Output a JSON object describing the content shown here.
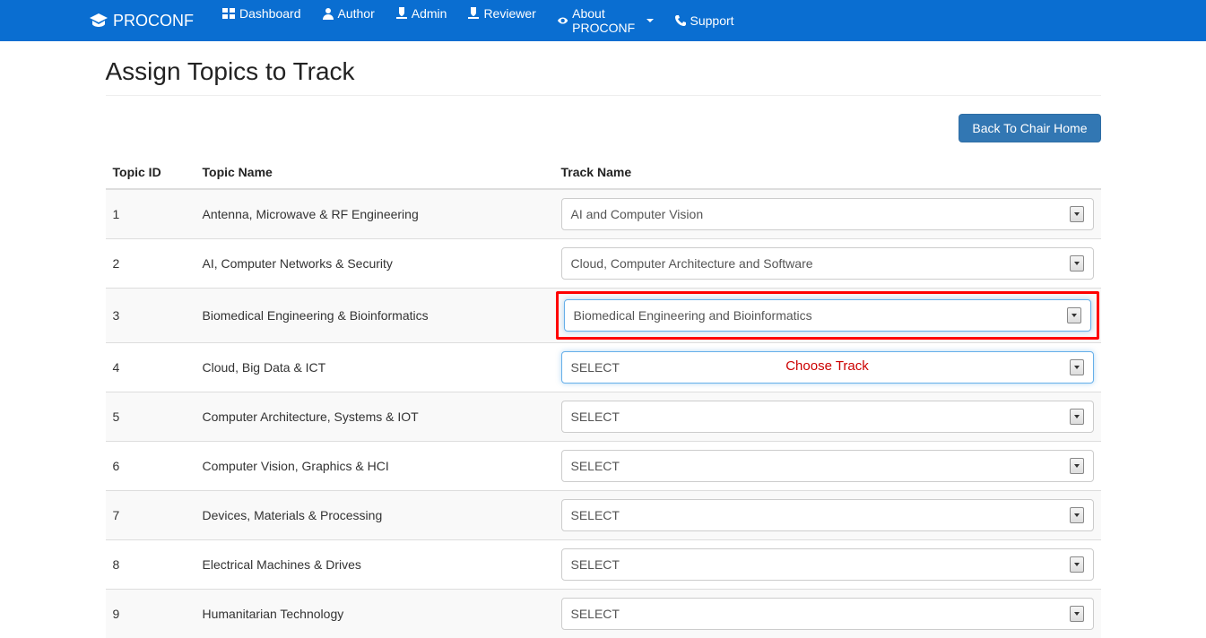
{
  "brand": "PROCONF",
  "nav": {
    "dashboard": "Dashboard",
    "author": "Author",
    "admin": "Admin",
    "reviewer": "Reviewer",
    "about": "About PROCONF",
    "support": "Support"
  },
  "page": {
    "title": "Assign Topics to Track",
    "back_btn": "Back To Chair Home",
    "annotation": "Choose Track"
  },
  "table": {
    "headers": {
      "id": "Topic ID",
      "name": "Topic Name",
      "track": "Track Name"
    },
    "rows": [
      {
        "id": "1",
        "name": "Antenna, Microwave & RF Engineering",
        "track": "AI and Computer Vision",
        "highlight": false,
        "focus": false
      },
      {
        "id": "2",
        "name": "AI, Computer Networks & Security",
        "track": "Cloud, Computer Architecture and Software",
        "highlight": false,
        "focus": false
      },
      {
        "id": "3",
        "name": "Biomedical Engineering & Bioinformatics",
        "track": "Biomedical Engineering and Bioinformatics",
        "highlight": true,
        "focus": true
      },
      {
        "id": "4",
        "name": "Cloud, Big Data & ICT",
        "track": "SELECT",
        "highlight": false,
        "focus": true,
        "annotation": true
      },
      {
        "id": "5",
        "name": "Computer Architecture, Systems & IOT",
        "track": "SELECT",
        "highlight": false,
        "focus": false
      },
      {
        "id": "6",
        "name": "Computer Vision, Graphics & HCI",
        "track": "SELECT",
        "highlight": false,
        "focus": false
      },
      {
        "id": "7",
        "name": "Devices, Materials & Processing",
        "track": "SELECT",
        "highlight": false,
        "focus": false
      },
      {
        "id": "8",
        "name": "Electrical Machines & Drives",
        "track": "SELECT",
        "highlight": false,
        "focus": false
      },
      {
        "id": "9",
        "name": "Humanitarian Technology",
        "track": "SELECT",
        "highlight": false,
        "focus": false
      }
    ]
  }
}
